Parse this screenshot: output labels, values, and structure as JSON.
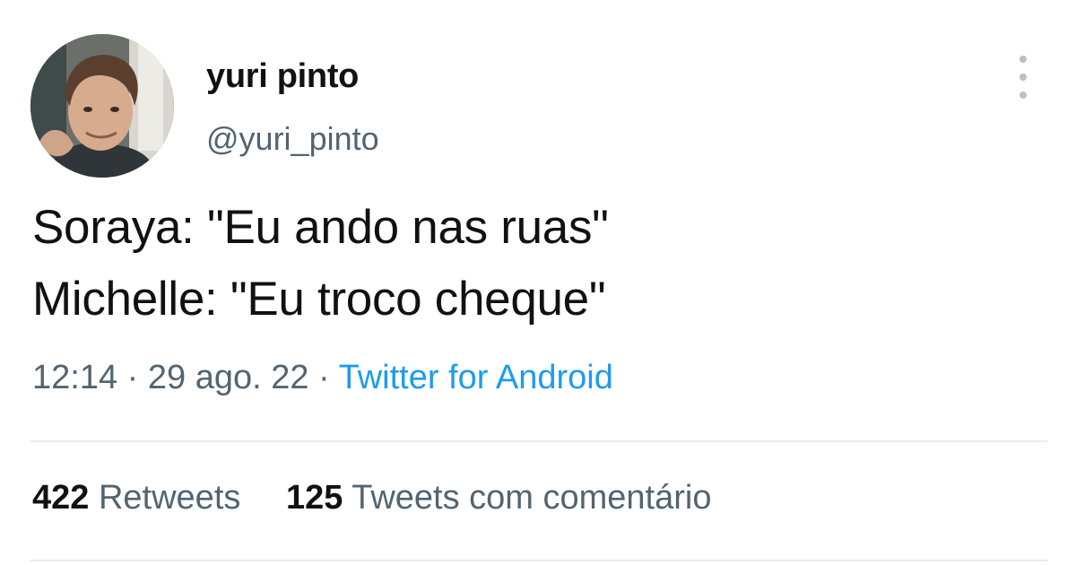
{
  "user": {
    "display_name": "yuri pinto",
    "handle": "@yuri_pinto"
  },
  "tweet": {
    "lines": [
      "Soraya: \"Eu ando nas ruas\"",
      "Michelle: \"Eu troco cheque\""
    ],
    "time": "12:14",
    "separator": "·",
    "date": "29 ago. 22",
    "source": "Twitter for Android"
  },
  "stats": {
    "retweets_count": "422",
    "retweets_label": "Retweets",
    "quotes_count": "125",
    "quotes_label": "Tweets com comentário"
  },
  "icons": {
    "more": "more-options-icon"
  },
  "colors": {
    "text": "#111111",
    "secondary": "#536471",
    "link": "#1d9bf0",
    "divider": "#e6ecf0"
  }
}
